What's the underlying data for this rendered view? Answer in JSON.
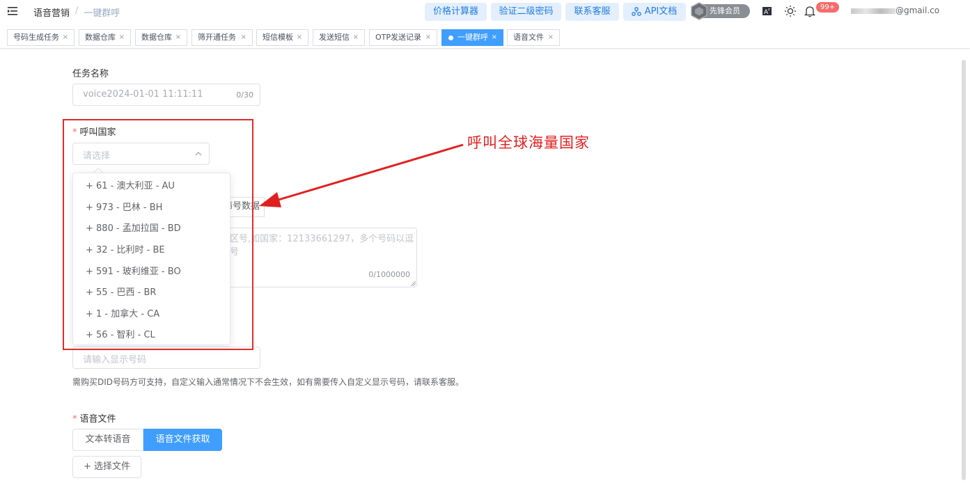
{
  "header": {
    "breadcrumb": [
      "语音营销",
      "/",
      "一键群呼"
    ],
    "buttons": [
      "价格计算器",
      "验证二级密码",
      "联系客服",
      "API文档"
    ],
    "vip_label": "先锋会员",
    "notification_badge": "99+",
    "email_suffix": "@gmail.co"
  },
  "tabs": [
    {
      "label": "号码生成任务"
    },
    {
      "label": "数据仓库"
    },
    {
      "label": "数据仓库"
    },
    {
      "label": "筛开通任务"
    },
    {
      "label": "短信模板"
    },
    {
      "label": "发送短信"
    },
    {
      "label": "OTP发送记录"
    },
    {
      "label": "一键群呼",
      "active": true
    },
    {
      "label": "语音文件"
    }
  ],
  "tab_close": "×",
  "form": {
    "task_name_label": "任务名称",
    "task_name_value": "voice2024-01-01 11:11:11",
    "task_name_count": "0/30",
    "country_label": "呼叫国家",
    "country_placeholder": "请选择",
    "country_options": [
      "+ 61 - 澳大利亚 - AU",
      "+ 973 - 巴林 - BH",
      "+ 880 - 孟加拉国 - BD",
      "+ 32 - 比利时 - BE",
      "+ 591 - 玻利维亚 - BO",
      "+ 55 - 巴西 - BR",
      "+ 1 - 加拿大 - CA",
      "+ 56 - 智利 - CL"
    ],
    "partial_button_text": "筛号数据",
    "numbers_placeholder_partial": "区号,如国家：12133661297，多个号码以逗号",
    "numbers_count": "0/1000000",
    "display_number_placeholder": "请输入显示号码",
    "display_number_hint": "需购买DID号码方可支持，自定义输入通常情况下不会生效，如有需要传入自定义显示号码，请联系客服。",
    "voice_file_label": "语音文件",
    "tts_button": "文本转语音",
    "fetch_button": "语音文件获取",
    "select_file_button": "+ 选择文件",
    "required_mark": "*"
  },
  "annotation": {
    "text": "呼叫全球海量国家",
    "color": "#e02020"
  },
  "colors": {
    "primary": "#409eff",
    "header_button_bg": "#e4effd",
    "header_button_text": "#1f7de0",
    "danger": "#f56c6c"
  }
}
